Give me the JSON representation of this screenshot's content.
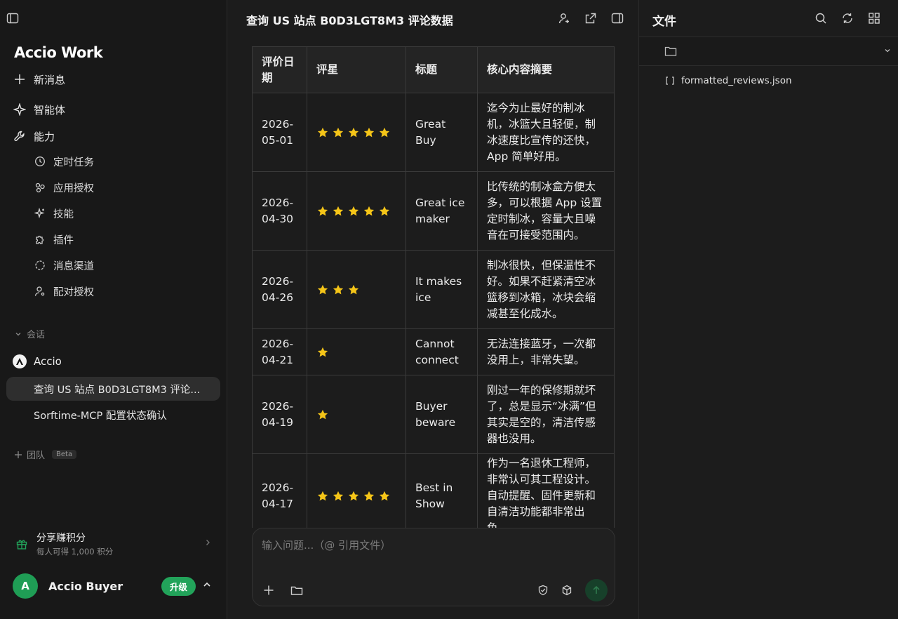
{
  "sidebar": {
    "logo": "Accio Work",
    "nav": {
      "new_message": "新消息",
      "agents": "智能体",
      "abilities": "能力"
    },
    "sub": {
      "scheduled": "定时任务",
      "app_auth": "应用授权",
      "skills": "技能",
      "plugins": "插件",
      "channels": "消息渠道",
      "pairing": "配对授权"
    },
    "sessions_label": "会话",
    "accio_label": "Accio",
    "conversations": [
      "查询 US 站点 B0D3LGT8M3 评论...",
      "Sorftime-MCP 配置状态确认"
    ],
    "team_label": "团队",
    "team_badge": "Beta",
    "share_title": "分享赚积分",
    "share_sub": "每人可得 1,000 积分",
    "user_initial": "A",
    "user_name": "Accio Buyer",
    "upgrade_label": "升级"
  },
  "main": {
    "title": "查询 US 站点 B0D3LGT8M3 评论数据",
    "table": {
      "headers": [
        "评价日期",
        "评星",
        "标题",
        "核心内容摘要"
      ],
      "rows": [
        {
          "date": "2026-05-01",
          "stars": 5,
          "title": "Great Buy",
          "summary": "迄今为止最好的制冰机，冰篮大且轻便，制冰速度比宣传的还快，App 简单好用。"
        },
        {
          "date": "2026-04-30",
          "stars": 5,
          "title": "Great ice maker",
          "summary": "比传统的制冰盒方便太多，可以根据 App 设置定时制冰，容量大且噪音在可接受范围内。"
        },
        {
          "date": "2026-04-26",
          "stars": 3,
          "title": "It makes ice",
          "summary": "制冰很快，但保温性不好。如果不赶紧清空冰篮移到冰箱，冰块会缩减甚至化成水。"
        },
        {
          "date": "2026-04-21",
          "stars": 1,
          "title": "Cannot connect",
          "summary": "无法连接蓝牙，一次都没用上，非常失望。"
        },
        {
          "date": "2026-04-19",
          "stars": 1,
          "title": "Buyer beware",
          "summary": "刚过一年的保修期就坏了，总是显示“冰满”但其实是空的，清洁传感器也没用。"
        },
        {
          "date": "2026-04-17",
          "stars": 5,
          "title": "Best in Show",
          "summary": "作为一名退休工程师，非常认可其工程设计。自动提醒、固件更新和自清洁功能都非常出色。"
        }
      ]
    },
    "composer_placeholder": "输入问题...（@ 引用文件）"
  },
  "files": {
    "title": "文件",
    "items": [
      "formatted_reviews.json"
    ]
  },
  "colors": {
    "accent_green": "#22a35a",
    "star": "#f5c518"
  }
}
